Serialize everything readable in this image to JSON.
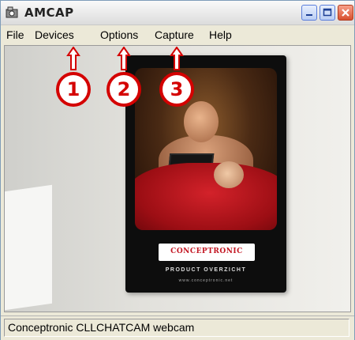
{
  "window": {
    "title": "AMCAP"
  },
  "menu": [
    {
      "label": "File"
    },
    {
      "label": "Devices"
    },
    {
      "label": "Options"
    },
    {
      "label": "Capture"
    },
    {
      "label": "Help"
    }
  ],
  "callouts": [
    "1",
    "2",
    "3"
  ],
  "preview": {
    "brand": "CONCEPTRONIC",
    "tagline": "PRODUCT OVERZICHT",
    "url": "www.conceptronic.net"
  },
  "status": {
    "text": "Conceptronic CLLCHATCAM webcam"
  },
  "colors": {
    "callout": "#d40000",
    "titlebar": "#e6e6e6",
    "menubar": "#ece9d8",
    "close_button": "#d8502e"
  }
}
